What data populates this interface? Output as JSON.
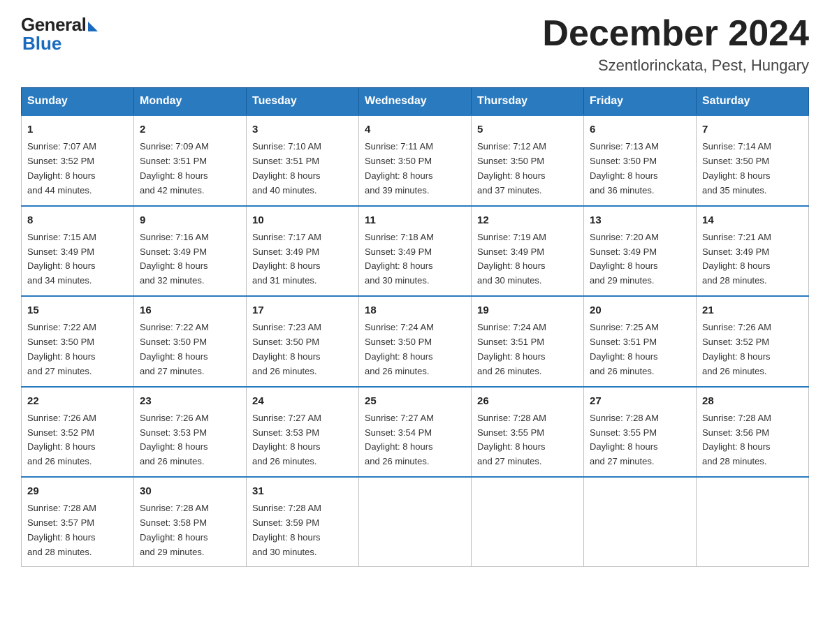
{
  "logo": {
    "general": "General",
    "blue": "Blue"
  },
  "title": "December 2024",
  "subtitle": "Szentlorinckata, Pest, Hungary",
  "headers": [
    "Sunday",
    "Monday",
    "Tuesday",
    "Wednesday",
    "Thursday",
    "Friday",
    "Saturday"
  ],
  "weeks": [
    [
      {
        "day": "1",
        "info": "Sunrise: 7:07 AM\nSunset: 3:52 PM\nDaylight: 8 hours\nand 44 minutes."
      },
      {
        "day": "2",
        "info": "Sunrise: 7:09 AM\nSunset: 3:51 PM\nDaylight: 8 hours\nand 42 minutes."
      },
      {
        "day": "3",
        "info": "Sunrise: 7:10 AM\nSunset: 3:51 PM\nDaylight: 8 hours\nand 40 minutes."
      },
      {
        "day": "4",
        "info": "Sunrise: 7:11 AM\nSunset: 3:50 PM\nDaylight: 8 hours\nand 39 minutes."
      },
      {
        "day": "5",
        "info": "Sunrise: 7:12 AM\nSunset: 3:50 PM\nDaylight: 8 hours\nand 37 minutes."
      },
      {
        "day": "6",
        "info": "Sunrise: 7:13 AM\nSunset: 3:50 PM\nDaylight: 8 hours\nand 36 minutes."
      },
      {
        "day": "7",
        "info": "Sunrise: 7:14 AM\nSunset: 3:50 PM\nDaylight: 8 hours\nand 35 minutes."
      }
    ],
    [
      {
        "day": "8",
        "info": "Sunrise: 7:15 AM\nSunset: 3:49 PM\nDaylight: 8 hours\nand 34 minutes."
      },
      {
        "day": "9",
        "info": "Sunrise: 7:16 AM\nSunset: 3:49 PM\nDaylight: 8 hours\nand 32 minutes."
      },
      {
        "day": "10",
        "info": "Sunrise: 7:17 AM\nSunset: 3:49 PM\nDaylight: 8 hours\nand 31 minutes."
      },
      {
        "day": "11",
        "info": "Sunrise: 7:18 AM\nSunset: 3:49 PM\nDaylight: 8 hours\nand 30 minutes."
      },
      {
        "day": "12",
        "info": "Sunrise: 7:19 AM\nSunset: 3:49 PM\nDaylight: 8 hours\nand 30 minutes."
      },
      {
        "day": "13",
        "info": "Sunrise: 7:20 AM\nSunset: 3:49 PM\nDaylight: 8 hours\nand 29 minutes."
      },
      {
        "day": "14",
        "info": "Sunrise: 7:21 AM\nSunset: 3:49 PM\nDaylight: 8 hours\nand 28 minutes."
      }
    ],
    [
      {
        "day": "15",
        "info": "Sunrise: 7:22 AM\nSunset: 3:50 PM\nDaylight: 8 hours\nand 27 minutes."
      },
      {
        "day": "16",
        "info": "Sunrise: 7:22 AM\nSunset: 3:50 PM\nDaylight: 8 hours\nand 27 minutes."
      },
      {
        "day": "17",
        "info": "Sunrise: 7:23 AM\nSunset: 3:50 PM\nDaylight: 8 hours\nand 26 minutes."
      },
      {
        "day": "18",
        "info": "Sunrise: 7:24 AM\nSunset: 3:50 PM\nDaylight: 8 hours\nand 26 minutes."
      },
      {
        "day": "19",
        "info": "Sunrise: 7:24 AM\nSunset: 3:51 PM\nDaylight: 8 hours\nand 26 minutes."
      },
      {
        "day": "20",
        "info": "Sunrise: 7:25 AM\nSunset: 3:51 PM\nDaylight: 8 hours\nand 26 minutes."
      },
      {
        "day": "21",
        "info": "Sunrise: 7:26 AM\nSunset: 3:52 PM\nDaylight: 8 hours\nand 26 minutes."
      }
    ],
    [
      {
        "day": "22",
        "info": "Sunrise: 7:26 AM\nSunset: 3:52 PM\nDaylight: 8 hours\nand 26 minutes."
      },
      {
        "day": "23",
        "info": "Sunrise: 7:26 AM\nSunset: 3:53 PM\nDaylight: 8 hours\nand 26 minutes."
      },
      {
        "day": "24",
        "info": "Sunrise: 7:27 AM\nSunset: 3:53 PM\nDaylight: 8 hours\nand 26 minutes."
      },
      {
        "day": "25",
        "info": "Sunrise: 7:27 AM\nSunset: 3:54 PM\nDaylight: 8 hours\nand 26 minutes."
      },
      {
        "day": "26",
        "info": "Sunrise: 7:28 AM\nSunset: 3:55 PM\nDaylight: 8 hours\nand 27 minutes."
      },
      {
        "day": "27",
        "info": "Sunrise: 7:28 AM\nSunset: 3:55 PM\nDaylight: 8 hours\nand 27 minutes."
      },
      {
        "day": "28",
        "info": "Sunrise: 7:28 AM\nSunset: 3:56 PM\nDaylight: 8 hours\nand 28 minutes."
      }
    ],
    [
      {
        "day": "29",
        "info": "Sunrise: 7:28 AM\nSunset: 3:57 PM\nDaylight: 8 hours\nand 28 minutes."
      },
      {
        "day": "30",
        "info": "Sunrise: 7:28 AM\nSunset: 3:58 PM\nDaylight: 8 hours\nand 29 minutes."
      },
      {
        "day": "31",
        "info": "Sunrise: 7:28 AM\nSunset: 3:59 PM\nDaylight: 8 hours\nand 30 minutes."
      },
      {
        "day": "",
        "info": ""
      },
      {
        "day": "",
        "info": ""
      },
      {
        "day": "",
        "info": ""
      },
      {
        "day": "",
        "info": ""
      }
    ]
  ]
}
